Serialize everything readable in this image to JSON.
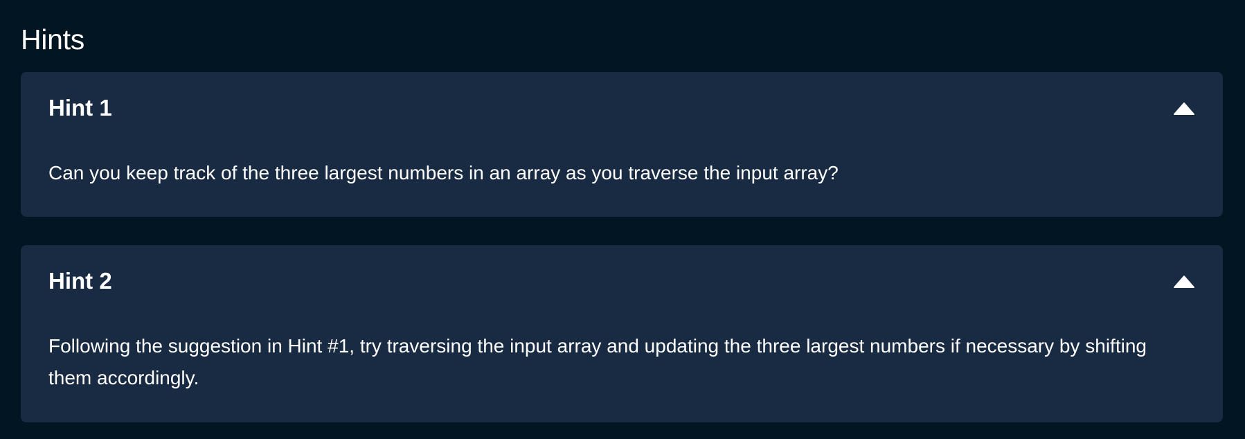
{
  "section": {
    "title": "Hints"
  },
  "hints": [
    {
      "title": "Hint 1",
      "body": "Can you keep track of the three largest numbers in an array as you traverse the input array?",
      "expanded": true,
      "toggle_icon": "chevron-up-icon"
    },
    {
      "title": "Hint 2",
      "body": "Following the suggestion in Hint #1, try traversing the input array and updating the three largest numbers if necessary by shifting them accordingly.",
      "expanded": true,
      "toggle_icon": "chevron-up-icon"
    }
  ],
  "colors": {
    "page_background": "#021523",
    "card_background": "#192b43",
    "text": "#ffffff"
  }
}
